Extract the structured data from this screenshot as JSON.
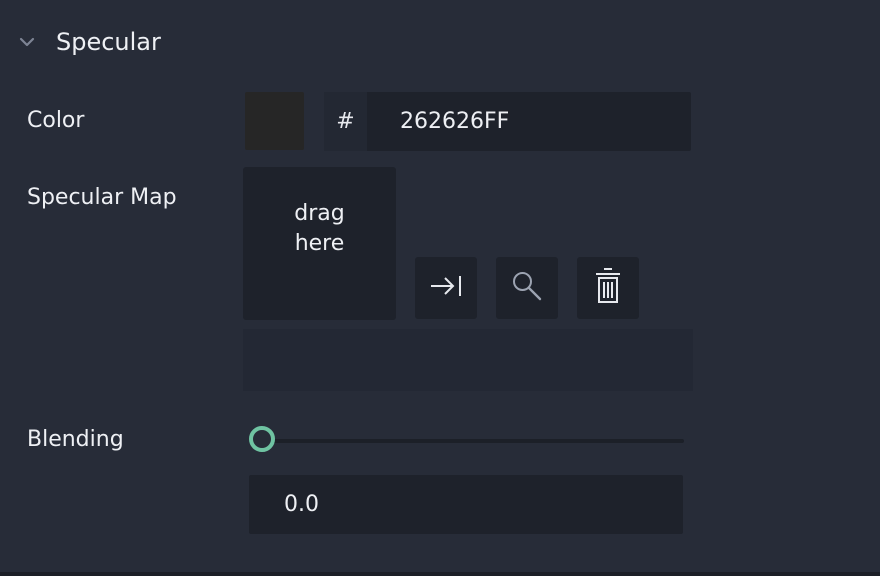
{
  "section": {
    "title": "Specular",
    "chevron_icon": "chevron-down-icon"
  },
  "color": {
    "label": "Color",
    "swatch_color": "#262626",
    "hash": "#",
    "hex": "262626FF"
  },
  "specular_map": {
    "label": "Specular Map",
    "dropzone_line1": "drag",
    "dropzone_line2": "here",
    "buttons": [
      {
        "icon": "assign-arrow-icon"
      },
      {
        "icon": "search-icon"
      },
      {
        "icon": "trash-icon"
      }
    ],
    "path_value": ""
  },
  "blending": {
    "label": "Blending",
    "slider_fraction": 0.0,
    "value": "0.0"
  },
  "colors": {
    "background": "#272c38",
    "field": "#1e222b",
    "accent": "#6fc3a2"
  }
}
